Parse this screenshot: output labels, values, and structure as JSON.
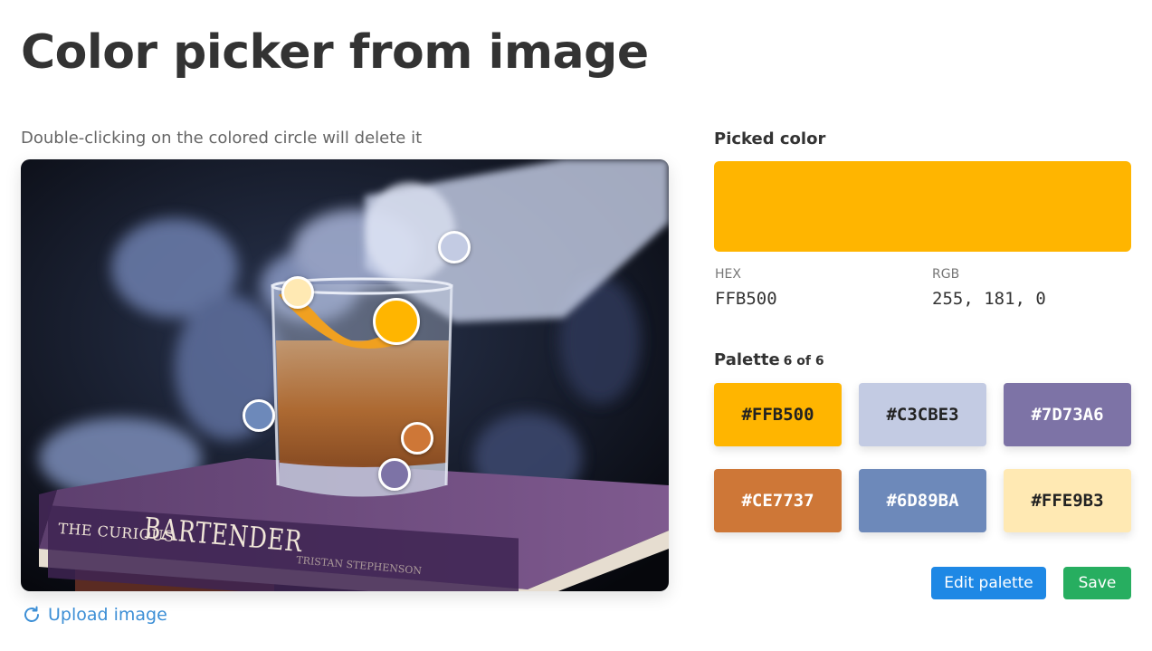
{
  "page": {
    "title": "Color picker from image",
    "hint": "Double-clicking on the colored circle will delete it",
    "upload_label": "Upload image",
    "upload_icon": "refresh-icon"
  },
  "photo": {
    "book_title_small": "THE CURIOUS",
    "book_title_big": "BARTENDER",
    "book_author": "TRISTAN STEPHENSON"
  },
  "pickers": [
    {
      "color": "#C3CBE3",
      "active": false
    },
    {
      "color": "#FFE9B3",
      "active": false
    },
    {
      "color": "#FFB500",
      "active": true
    },
    {
      "color": "#6D89BA",
      "active": false
    },
    {
      "color": "#CE7737",
      "active": false
    },
    {
      "color": "#7D73A6",
      "active": false
    }
  ],
  "picked": {
    "label": "Picked color",
    "color": "#FFB500",
    "hex_label": "HEX",
    "hex_value": "FFB500",
    "rgb_label": "RGB",
    "rgb_value": "255, 181, 0"
  },
  "palette": {
    "label": "Palette",
    "count": "6 of 6",
    "colors": [
      {
        "hex": "#FFB500",
        "text_color": "#222222"
      },
      {
        "hex": "#C3CBE3",
        "text_color": "#222222"
      },
      {
        "hex": "#7D73A6",
        "text_color": "#ffffff"
      },
      {
        "hex": "#CE7737",
        "text_color": "#ffffff"
      },
      {
        "hex": "#6D89BA",
        "text_color": "#ffffff"
      },
      {
        "hex": "#FFE9B3",
        "text_color": "#222222"
      }
    ]
  },
  "actions": {
    "edit_label": "Edit palette",
    "save_label": "Save"
  }
}
